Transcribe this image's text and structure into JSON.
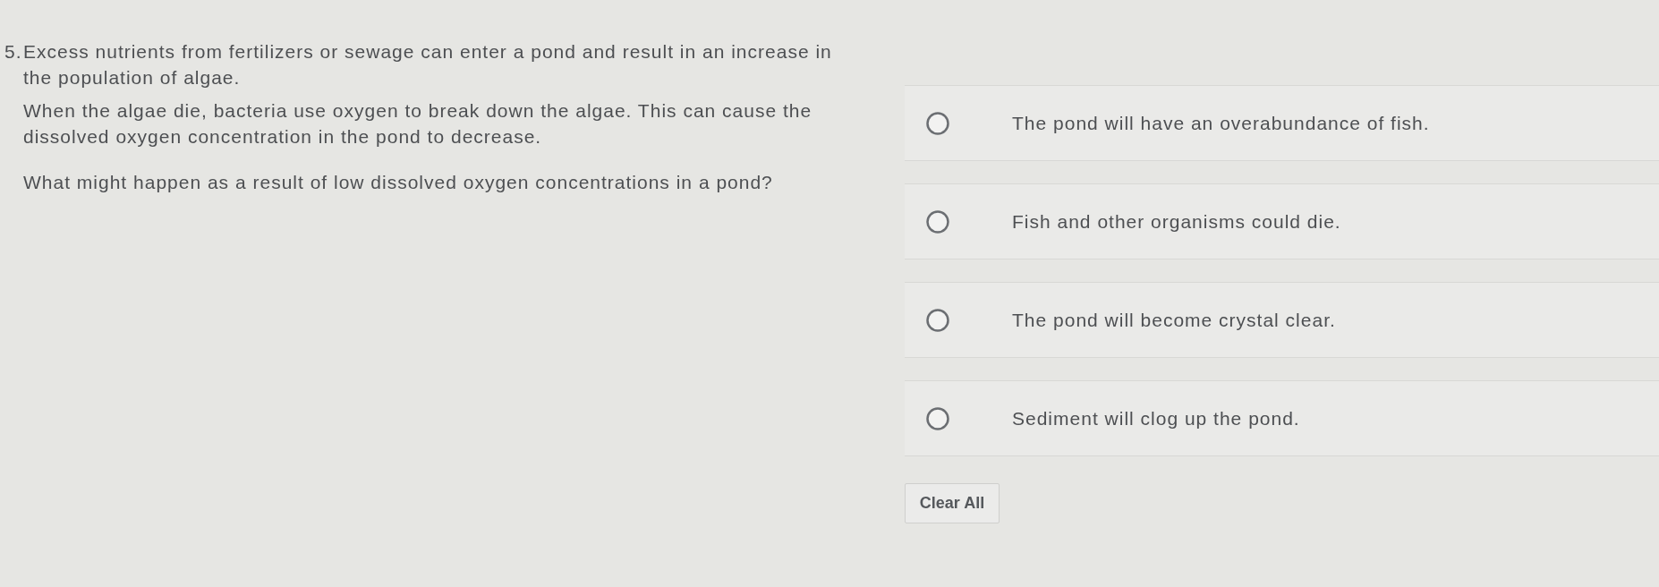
{
  "question": {
    "number": "5.",
    "paragraphs": [
      "Excess nutrients from fertilizers or sewage can enter a pond and result in an increase in the population of algae.",
      "When the algae die, bacteria use oxygen to break down the algae. This can cause the dissolved oxygen concentration in the pond to decrease."
    ],
    "prompt": "What might happen as a result of low dissolved oxygen concentrations in a pond?"
  },
  "options": [
    {
      "label": "The pond will have an overabundance of fish.",
      "selected": false
    },
    {
      "label": "Fish and other organisms could die.",
      "selected": false
    },
    {
      "label": "The pond will become crystal clear.",
      "selected": false
    },
    {
      "label": "Sediment will clog up the pond.",
      "selected": false
    }
  ],
  "clear_button": {
    "label": "Clear All"
  }
}
